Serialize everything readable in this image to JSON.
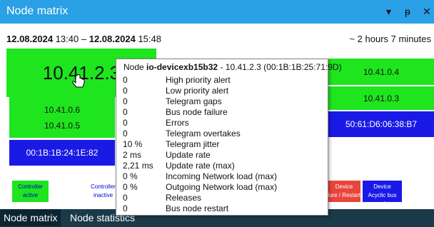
{
  "window": {
    "title": "Node matrix",
    "dropdown_glyph": "▾",
    "pin_glyph": "ᵽ",
    "close_glyph": "✕"
  },
  "time": {
    "start_date": "12.08.2024",
    "start_time": "13:40",
    "end_date": "12.08.2024",
    "end_time": "15:48",
    "duration": "~ 2 hours 7 minutes"
  },
  "nodes": {
    "n1": "10.41.2.3",
    "n2": "10.41.0.6",
    "n3": "10.41.0.5",
    "n4": "00:1B:1B:24:1E:82",
    "n5": "10.41.0.4",
    "n6": "10.41.0.3",
    "n7": "50:61:D6:06:38:B7"
  },
  "legend": {
    "controller_active": {
      "title": "Controller",
      "state": "active"
    },
    "controller_inactive": {
      "title": "Controller",
      "state": "inactive"
    },
    "device_failure": {
      "title": "Device",
      "state": "Bus node failure / Restart"
    },
    "device_acyclic": {
      "title": "Device",
      "state": "Acyclic bus node"
    }
  },
  "tooltip": {
    "header_prefix": "Node",
    "device_name": "io-devicexb15b32",
    "ip": "10.41.2.3",
    "mac": "00:1B:1B:25:71:9D",
    "rows": [
      {
        "value": "0",
        "label": "High priority alert"
      },
      {
        "value": "0",
        "label": "Low priority alert"
      },
      {
        "value": "0",
        "label": "Telegram gaps"
      },
      {
        "value": "0",
        "label": "Bus node failure"
      },
      {
        "value": "0",
        "label": "Errors"
      },
      {
        "value": "0",
        "label": "Telegram overtakes"
      },
      {
        "value": "10 %",
        "label": "Telegram jitter"
      },
      {
        "value": "2 ms",
        "label": "Update rate"
      },
      {
        "value": "2,21 ms",
        "label": "Update rate (max)"
      },
      {
        "value": "0 %",
        "label": "Incoming Network load (max)"
      },
      {
        "value": "0 %",
        "label": "Outgoing Network load (max)"
      },
      {
        "value": "0",
        "label": "Releases"
      },
      {
        "value": "0",
        "label": "Bus node restart"
      }
    ]
  },
  "tabs": {
    "matrix": "Node matrix",
    "statistics": "Node statistics"
  },
  "colors": {
    "titlebar": "#2aa0e6",
    "active_green": "#1ee51e",
    "blue": "#1a1ae6",
    "failure_red": "#e8453c",
    "tabbar": "#1a3a4a"
  }
}
